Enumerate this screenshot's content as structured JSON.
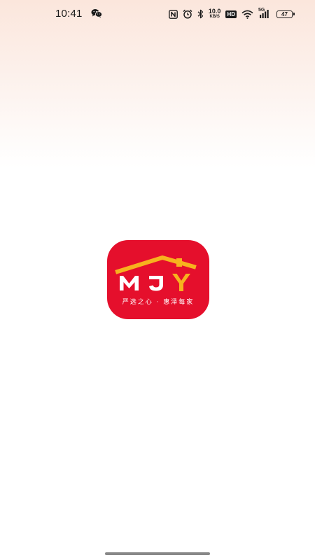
{
  "status_bar": {
    "time": "10:41",
    "notification_icons": [
      "wechat-icon"
    ],
    "icons": [
      "nfc-icon",
      "alarm-icon",
      "bluetooth-icon"
    ],
    "network_speed_value": "10.0",
    "network_speed_unit": "KB/S",
    "hd_label": "HD",
    "signal_label": "5G",
    "battery_level": "47"
  },
  "app_logo": {
    "brand_letters": [
      "M",
      "J",
      "Y"
    ],
    "tagline": "严选之心 · 惠泽每家",
    "colors": {
      "background": "#e50f2c",
      "roof": "#f7b21e",
      "letters_primary": "#ffffff",
      "letter_accent": "#f7b21e"
    }
  }
}
